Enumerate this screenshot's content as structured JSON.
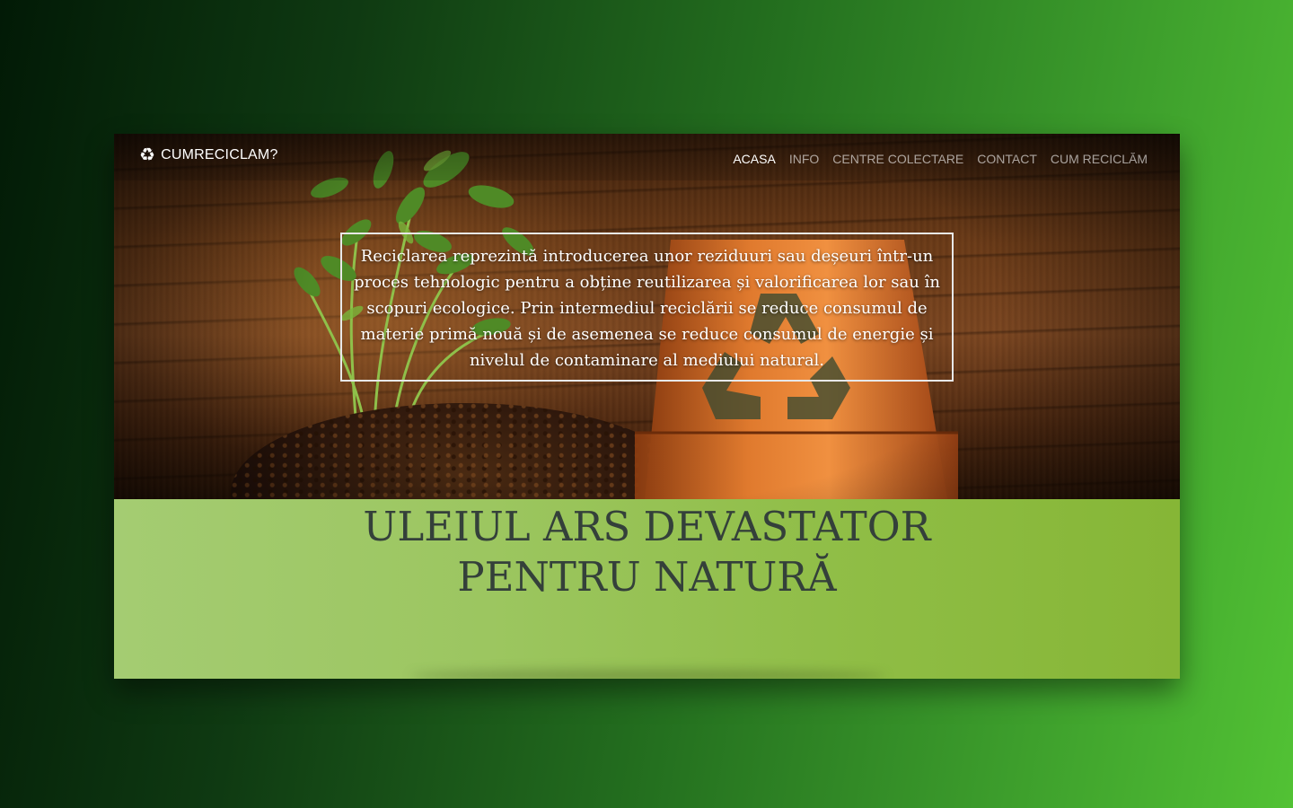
{
  "brand": {
    "icon": "recycle-icon",
    "name": "CUMRECICLAM?"
  },
  "nav": {
    "items": [
      {
        "label": "ACASA",
        "active": true
      },
      {
        "label": "INFO",
        "active": false
      },
      {
        "label": "CENTRE COLECTARE",
        "active": false
      },
      {
        "label": "CONTACT",
        "active": false
      },
      {
        "label": "CUM RECICLĂM",
        "active": false
      }
    ]
  },
  "hero": {
    "intro_text": "Reciclarea reprezintă introducerea unor reziduuri sau deșeuri într-un proces tehnologic pentru a obține reutilizarea și valorificarea lor sau în scopuri ecologice. Prin intermediul reciclării se reduce consumul de materie primă nouă și de asemenea se reduce consumul de energie și nivelul de contaminare al mediului natural."
  },
  "section": {
    "headline_line1": "ULEIUL ARS DEVASTATOR",
    "headline_line2": "PENTRU NATURĂ"
  },
  "colors": {
    "background_dark": "#021a06",
    "background_light": "#52c234",
    "section_green": "#8fbd45",
    "headline_text": "#34403a",
    "pot_orange": "#e06a22"
  }
}
